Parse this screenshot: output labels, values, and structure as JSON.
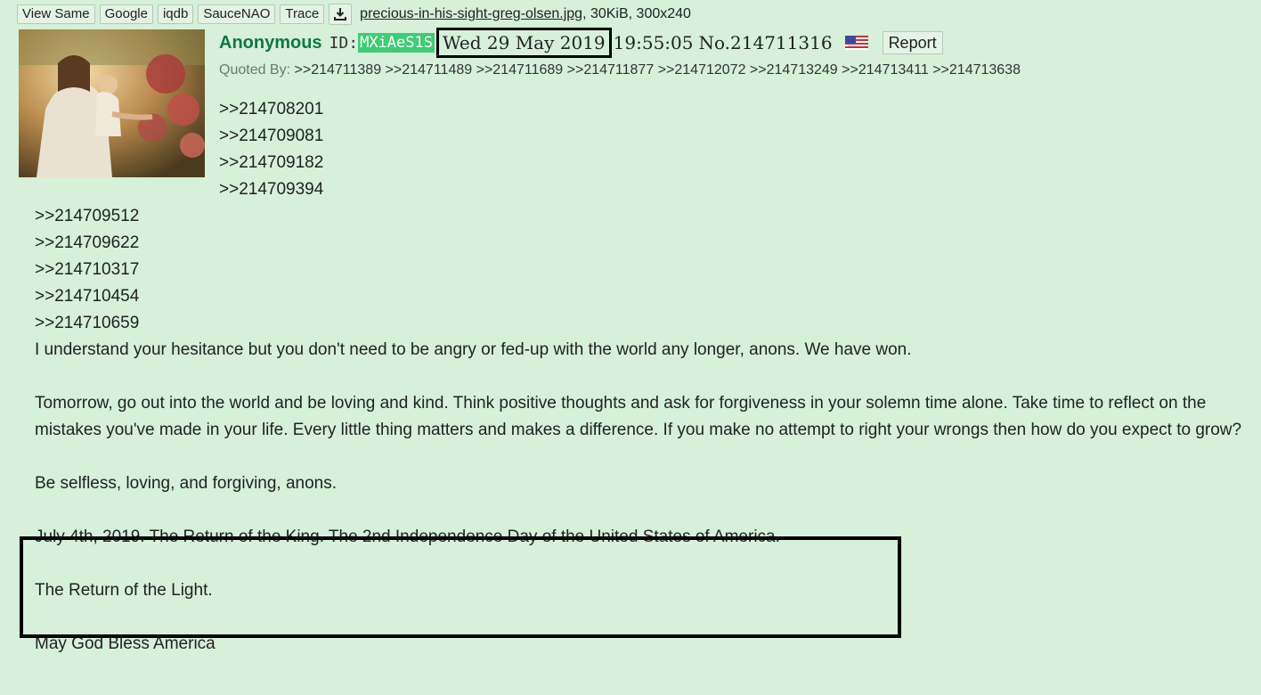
{
  "toolbar": {
    "buttons": [
      "View Same",
      "Google",
      "iqdb",
      "SauceNAO",
      "Trace"
    ],
    "download_icon": "download-icon",
    "file_name": "precious-in-his-sight-greg-olsen.jpg",
    "file_meta": ", 30KiB, 300x240"
  },
  "post": {
    "name": "Anonymous",
    "id_label": "ID:",
    "id_value": "MXiAeS1S",
    "date": "Wed 29 May 2019",
    "time": "19:55:05",
    "post_no": "No.214711316",
    "flag_icon": "us-flag-icon",
    "report_label": "Report",
    "quoted_by_label": "Quoted By:",
    "quoted_by": [
      ">>214711389",
      ">>214711489",
      ">>214711689",
      ">>214711877",
      ">>214712072",
      ">>214713249",
      ">>214713411",
      ">>214713638"
    ],
    "quote_links_right": [
      ">>214708201",
      ">>214709081",
      ">>214709182",
      ">>214709394"
    ],
    "quote_links_left": [
      ">>214709512",
      ">>214709622",
      ">>214710317",
      ">>214710454",
      ">>214710659"
    ],
    "paragraphs": [
      "I understand your hesitance but you don't need to be angry or fed-up with the world any longer, anons. We have won.",
      "Tomorrow, go out into the world and be loving and kind. Think positive thoughts and ask for forgiveness in your solemn time alone. Take time to reflect on the mistakes you've made in your life. Every little thing matters and makes a difference. If you make no attempt to right your wrongs then how do you expect to grow?",
      "Be selfless, loving, and forgiving, anons.",
      "July 4th, 2019. The Return of the King. The 2nd Independence Day of the United States of America.",
      "The Return of the Light.",
      "May God Bless America"
    ]
  },
  "colors": {
    "background": "#d6f0da",
    "name": "#117743",
    "id_badge": "#3fcd73"
  }
}
